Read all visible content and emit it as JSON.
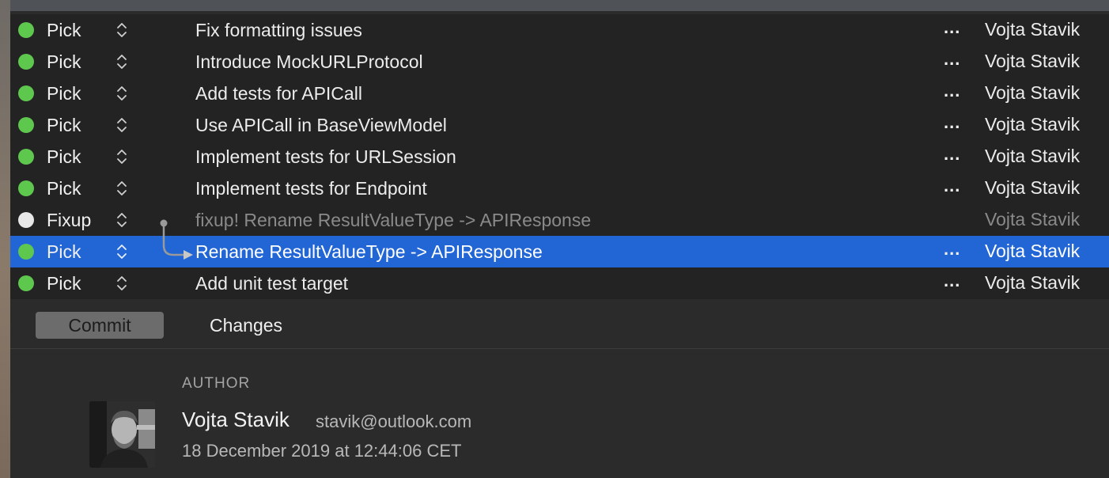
{
  "commits": [
    {
      "action": "Pick",
      "message": "Fix formatting issues",
      "more": "...",
      "author": "Vojta Stavik"
    },
    {
      "action": "Pick",
      "message": "Introduce MockURLProtocol",
      "more": "...",
      "author": "Vojta Stavik"
    },
    {
      "action": "Pick",
      "message": "Add tests for APICall",
      "more": "...",
      "author": "Vojta Stavik"
    },
    {
      "action": "Pick",
      "message": "Use APICall in BaseViewModel",
      "more": "...",
      "author": "Vojta Stavik"
    },
    {
      "action": "Pick",
      "message": "Implement tests for URLSession",
      "more": "...",
      "author": "Vojta Stavik"
    },
    {
      "action": "Pick",
      "message": "Implement tests for Endpoint",
      "more": "...",
      "author": "Vojta Stavik"
    },
    {
      "action": "Fixup",
      "message": "fixup! Rename ResultValueType -> APIResponse",
      "more": "",
      "author": "Vojta Stavik"
    },
    {
      "action": "Pick",
      "message": "Rename ResultValueType -> APIResponse",
      "more": "...",
      "author": "Vojta Stavik"
    },
    {
      "action": "Pick",
      "message": "Add unit test target",
      "more": "...",
      "author": "Vojta Stavik"
    }
  ],
  "tabs": {
    "commit": "Commit",
    "changes": "Changes"
  },
  "detail": {
    "author_label": "AUTHOR",
    "author_name": "Vojta Stavik",
    "author_email": "stavik@outlook.com",
    "date": "18 December 2019 at 12:44:06 CET"
  },
  "colors": {
    "pick_dot": "#5ec84e",
    "fixup_dot": "#e8e8e8",
    "selection": "#2266d6",
    "list_background": "#232323"
  },
  "icons": {
    "action_stepper": "up-down-chevron-icon",
    "fixup_connector": "fixup-arrow-icon"
  }
}
